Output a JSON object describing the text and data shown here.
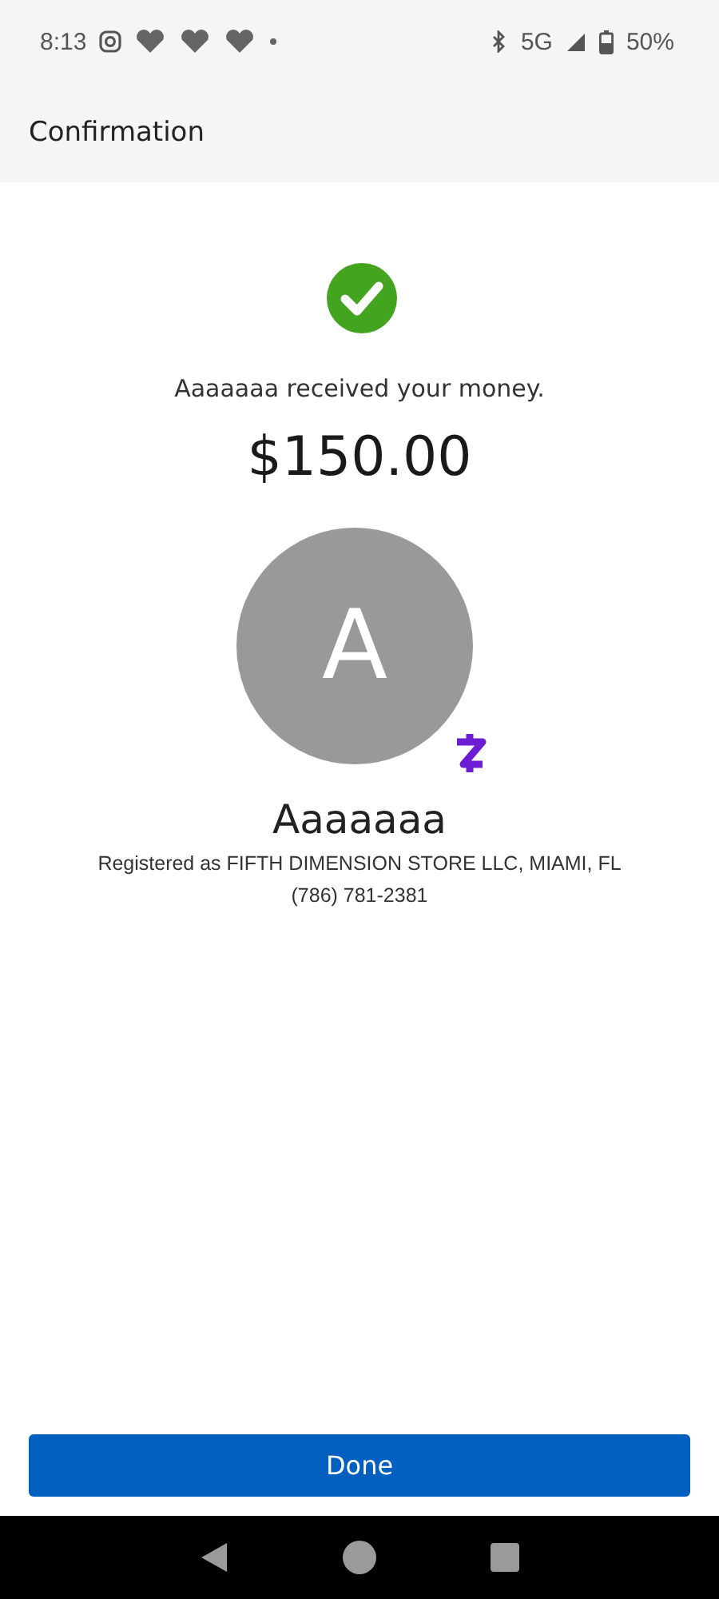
{
  "status_bar": {
    "time": "8:13",
    "network": "5G",
    "battery": "50%"
  },
  "header": {
    "title": "Confirmation"
  },
  "confirmation": {
    "message": "Aaaaaaa received your money.",
    "amount": "$150.00"
  },
  "recipient": {
    "initial": "A",
    "name": "Aaaaaaa",
    "registered": "Registered as FIFTH DIMENSION STORE LLC, MIAMI, FL",
    "phone": "(786) 781-2381"
  },
  "buttons": [
    {
      "label": "Done",
      "kind": "primary"
    }
  ]
}
